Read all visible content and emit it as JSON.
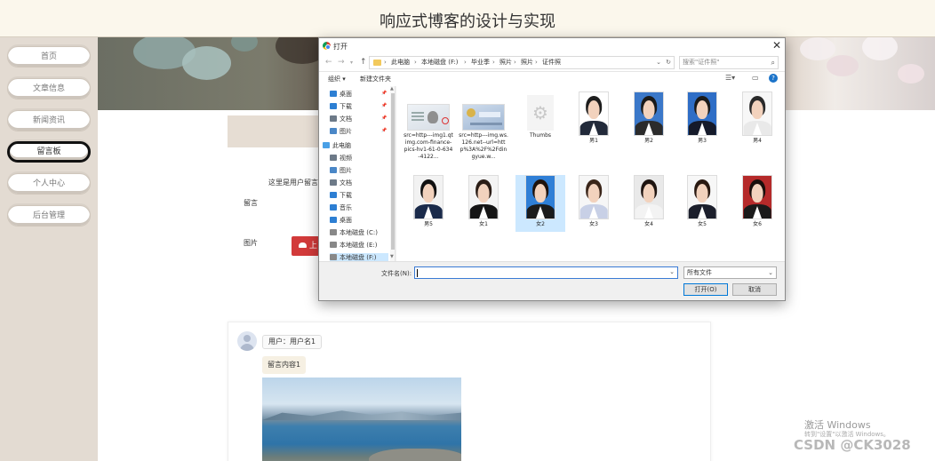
{
  "site": {
    "title": "响应式博客的设计与实现"
  },
  "sidebar": {
    "items": [
      {
        "label": "首页"
      },
      {
        "label": "文章信息"
      },
      {
        "label": "新闻资讯"
      },
      {
        "label": "留言板",
        "active": true
      },
      {
        "label": "个人中心"
      },
      {
        "label": "后台管理"
      }
    ]
  },
  "form": {
    "hint_text": "这里是用户留言",
    "message_label": "留言",
    "image_label": "图片",
    "upload_label": "上",
    "upload_icon": "cloud-upload-icon",
    "upload_color": "#d23a3a"
  },
  "comment": {
    "user": "用户：用户名1",
    "body": "留言内容1"
  },
  "overlay": {
    "activate_line1": "激活 Windows",
    "activate_line2": "转到\"设置\"以激活 Windows。",
    "csdn": "CSDN @CK3028"
  },
  "dialog": {
    "title": "打开",
    "close_icon": "close-icon",
    "breadcrumbs": [
      "此电脑",
      "本地磁盘 (F:)",
      "毕业季",
      "照片",
      "照片",
      "证件照"
    ],
    "search_placeholder": "搜索\"证件照\"",
    "toolbar": {
      "organize": "组织 ▾",
      "new_folder": "新建文件夹"
    },
    "nav_tree": [
      {
        "label": "桌面",
        "icon": "desktop-icon",
        "pinned": true,
        "color": "#2d7fd3"
      },
      {
        "label": "下载",
        "icon": "download-icon",
        "pinned": true,
        "color": "#2d7fd3"
      },
      {
        "label": "文档",
        "icon": "document-icon",
        "pinned": true,
        "color": "#6d7a88"
      },
      {
        "label": "图片",
        "icon": "picture-icon",
        "pinned": true,
        "color": "#4a87c7"
      },
      {
        "label": "此电脑",
        "icon": "computer-icon",
        "pinned": false,
        "color": "#4aa0e6"
      },
      {
        "label": "视频",
        "icon": "video-icon",
        "pinned": false,
        "color": "#6d7a88"
      },
      {
        "label": "图片",
        "icon": "picture-icon",
        "pinned": false,
        "color": "#4a87c7"
      },
      {
        "label": "文档",
        "icon": "document-icon",
        "pinned": false,
        "color": "#6d7a88"
      },
      {
        "label": "下载",
        "icon": "download-icon",
        "pinned": false,
        "color": "#2d7fd3"
      },
      {
        "label": "音乐",
        "icon": "music-icon",
        "pinned": false,
        "color": "#2d7fd3"
      },
      {
        "label": "桌面",
        "icon": "desktop-icon",
        "pinned": false,
        "color": "#2d7fd3"
      },
      {
        "label": "本地磁盘 (C:)",
        "icon": "drive-icon",
        "pinned": false,
        "color": "#888"
      },
      {
        "label": "本地磁盘 (E:)",
        "icon": "drive-icon",
        "pinned": false,
        "color": "#888"
      },
      {
        "label": "本地磁盘 (F:)",
        "icon": "drive-icon",
        "pinned": false,
        "color": "#888",
        "selected": true
      }
    ],
    "files_row1": [
      {
        "label": "src=http---img1.qtimg.com-finance-pics-hv1-61-0-634-4122...",
        "kind": "idcard-back"
      },
      {
        "label": "src=http---img.ws.126.net--url=http%3A%2F%2Fdingyue.w...",
        "kind": "idcard-front"
      },
      {
        "label": "Thumbs",
        "kind": "system"
      },
      {
        "label": "男1",
        "kind": "photo",
        "bg": "#ffffff",
        "hair": "#1d1d1d",
        "suit": "#222a3a"
      },
      {
        "label": "男2",
        "kind": "photo",
        "bg": "#3b78c9",
        "hair": "#1a1a1a",
        "suit": "#2b2b2b"
      },
      {
        "label": "男3",
        "kind": "photo",
        "bg": "#2f6ec6",
        "hair": "#1a1a1a",
        "suit": "#151a2a"
      },
      {
        "label": "男4",
        "kind": "photo",
        "bg": "#f7f7f7",
        "hair": "#2a2a2a",
        "suit": "#e9e9e9"
      }
    ],
    "files_row2": [
      {
        "label": "男5",
        "kind": "photo",
        "bg": "#f2f2f2",
        "hair": "#111111",
        "suit": "#1a2a4a"
      },
      {
        "label": "女1",
        "kind": "photo",
        "bg": "#f4f4f4",
        "hair": "#2b1d16",
        "suit": "#151515"
      },
      {
        "label": "女2",
        "kind": "photo",
        "bg": "#2f7fd6",
        "hair": "#1e120c",
        "suit": "#1b1b1b",
        "selected": true
      },
      {
        "label": "女3",
        "kind": "photo",
        "bg": "#f6f6f6",
        "hair": "#3a2519",
        "suit": "#c8d0e6"
      },
      {
        "label": "女4",
        "kind": "photo",
        "bg": "#e9e9e9",
        "hair": "#1e1410",
        "suit": "#f3f3f3"
      },
      {
        "label": "女5",
        "kind": "photo",
        "bg": "#f7f7f7",
        "hair": "#2a1a12",
        "suit": "#1c1f2c"
      },
      {
        "label": "女6",
        "kind": "photo",
        "bg": "#b52a2a",
        "hair": "#1a0f0c",
        "suit": "#1a1a1a"
      }
    ],
    "filename_label": "文件名(N):",
    "filename_value": "",
    "filetype_value": "所有文件",
    "open_label": "打开(O)",
    "cancel_label": "取消"
  }
}
